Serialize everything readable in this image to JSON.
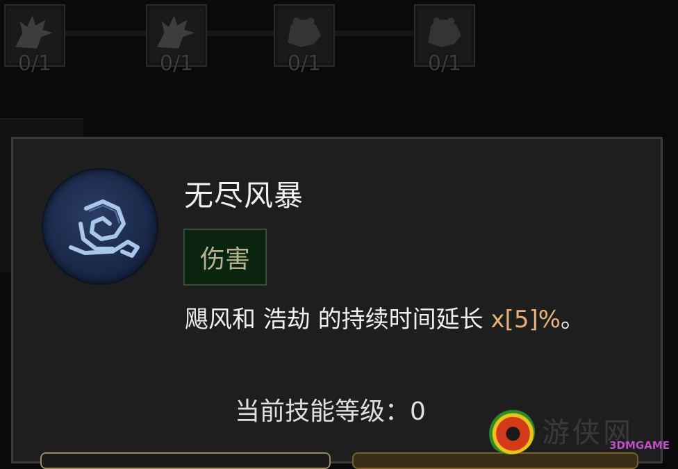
{
  "skill_nodes": [
    {
      "icon": "wolf-icon",
      "count": "0/1"
    },
    {
      "icon": "wolf-icon",
      "count": "0/1"
    },
    {
      "icon": "bear-icon",
      "count": "0/1"
    },
    {
      "icon": "bear-icon",
      "count": "0/1"
    }
  ],
  "tooltip": {
    "title": "无尽风暴",
    "emblem_icon": "storm-swirl-icon",
    "tag": "伤害",
    "description_prefix": "飓风和 浩劫 的持续时间延长 ",
    "description_value": "x[5]%",
    "description_suffix": "。",
    "level_text": "当前技能等级：0"
  },
  "watermark": {
    "text": "游侠网",
    "brand": "3DMGAME"
  },
  "colors": {
    "value_highlight": "#e6b27a",
    "tag_background": "#0b240f",
    "tag_text": "#b8b291"
  }
}
